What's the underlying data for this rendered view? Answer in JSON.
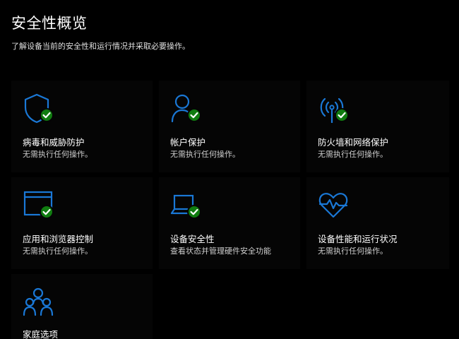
{
  "header": {
    "title": "安全性概览",
    "subtitle": "了解设备当前的安全性和运行情况并采取必要操作。"
  },
  "colors": {
    "background": "#000000",
    "tile": "#050505",
    "icon_blue": "#1a78d6",
    "check_green": "#107c10"
  },
  "tiles": [
    {
      "icon": "shield-icon",
      "label": "病毒和威胁防护",
      "status": "无需执行任何操作。",
      "ok": true
    },
    {
      "icon": "account-icon",
      "label": "帐户保护",
      "status": "无需执行任何操作。",
      "ok": true
    },
    {
      "icon": "wifi-antenna-icon",
      "label": "防火墙和网络保护",
      "status": "无需执行任何操作。",
      "ok": true
    },
    {
      "icon": "browser-window-icon",
      "label": "应用和浏览器控制",
      "status": "无需执行任何操作。",
      "ok": true
    },
    {
      "icon": "laptop-icon",
      "label": "设备安全性",
      "status": "查看状态并管理硬件安全功能",
      "ok": true
    },
    {
      "icon": "heart-pulse-icon",
      "label": "设备性能和运行状况",
      "status": "无需执行任何操作。",
      "ok": false
    },
    {
      "icon": "family-icon",
      "label": "家庭选项",
      "status": "",
      "ok": false
    }
  ]
}
